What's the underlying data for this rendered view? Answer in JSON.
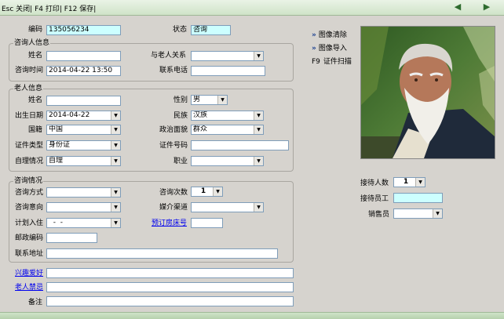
{
  "toolbar": {
    "shortcuts": "Esc 关闭| F4 打印| F12 保存|",
    "prev_icon": "arrow-left-icon",
    "next_icon": "arrow-right-icon"
  },
  "header": {
    "code_label": "编码",
    "code_value": "135056234",
    "status_label": "状态",
    "status_value": "咨询"
  },
  "consultant": {
    "title": "咨询人信息",
    "name_label": "姓名",
    "name_value": "",
    "relation_label": "与老人关系",
    "relation_value": "",
    "time_label": "咨询时间",
    "time_value": "2014-04-22 13:50",
    "phone_label": "联系电话",
    "phone_value": ""
  },
  "elder": {
    "title": "老人信息",
    "name_label": "姓名",
    "name_value": "",
    "gender_label": "性别",
    "gender_value": "男",
    "birth_label": "出生日期",
    "birth_value": "2014-04-22",
    "ethnic_label": "民族",
    "ethnic_value": "汉族",
    "nationality_label": "国籍",
    "nationality_value": "中国",
    "political_label": "政治面貌",
    "political_value": "群众",
    "idtype_label": "证件类型",
    "idtype_value": "身份证",
    "idno_label": "证件号码",
    "idno_value": "",
    "selfcare_label": "自理情况",
    "selfcare_value": "自理",
    "job_label": "职业",
    "job_value": ""
  },
  "consult": {
    "title": "咨询情况",
    "method_label": "咨询方式",
    "method_value": "",
    "count_label": "咨询次数",
    "count_value": "1",
    "intent_label": "咨询意向",
    "intent_value": "",
    "media_label": "媒介渠道",
    "media_value": "",
    "plan_label": "计划入住",
    "plan_value": "  -  -",
    "room_label": "预订房床号",
    "room_value": "",
    "zip_label": "邮政编码",
    "zip_value": "",
    "addr_label": "联系地址",
    "addr_value": ""
  },
  "extra": {
    "hobby_label": "兴趣爱好",
    "hobby_value": "",
    "taboo_label": "老人禁忌",
    "taboo_value": "",
    "remark_label": "备注",
    "remark_value": ""
  },
  "image_actions": {
    "clear_label": "图像清除",
    "import_label": "图像导入",
    "scan_key": "F9",
    "scan_label": "证件扫描"
  },
  "reception": {
    "count_label": "接待人数",
    "count_value": "1",
    "staff_label": "接待员工",
    "staff_value": "",
    "sales_label": "销售员",
    "sales_value": ""
  },
  "colors": {
    "accent_input": "#ccffff",
    "link": "#0000ee",
    "toolbar": "#d9ead3"
  }
}
